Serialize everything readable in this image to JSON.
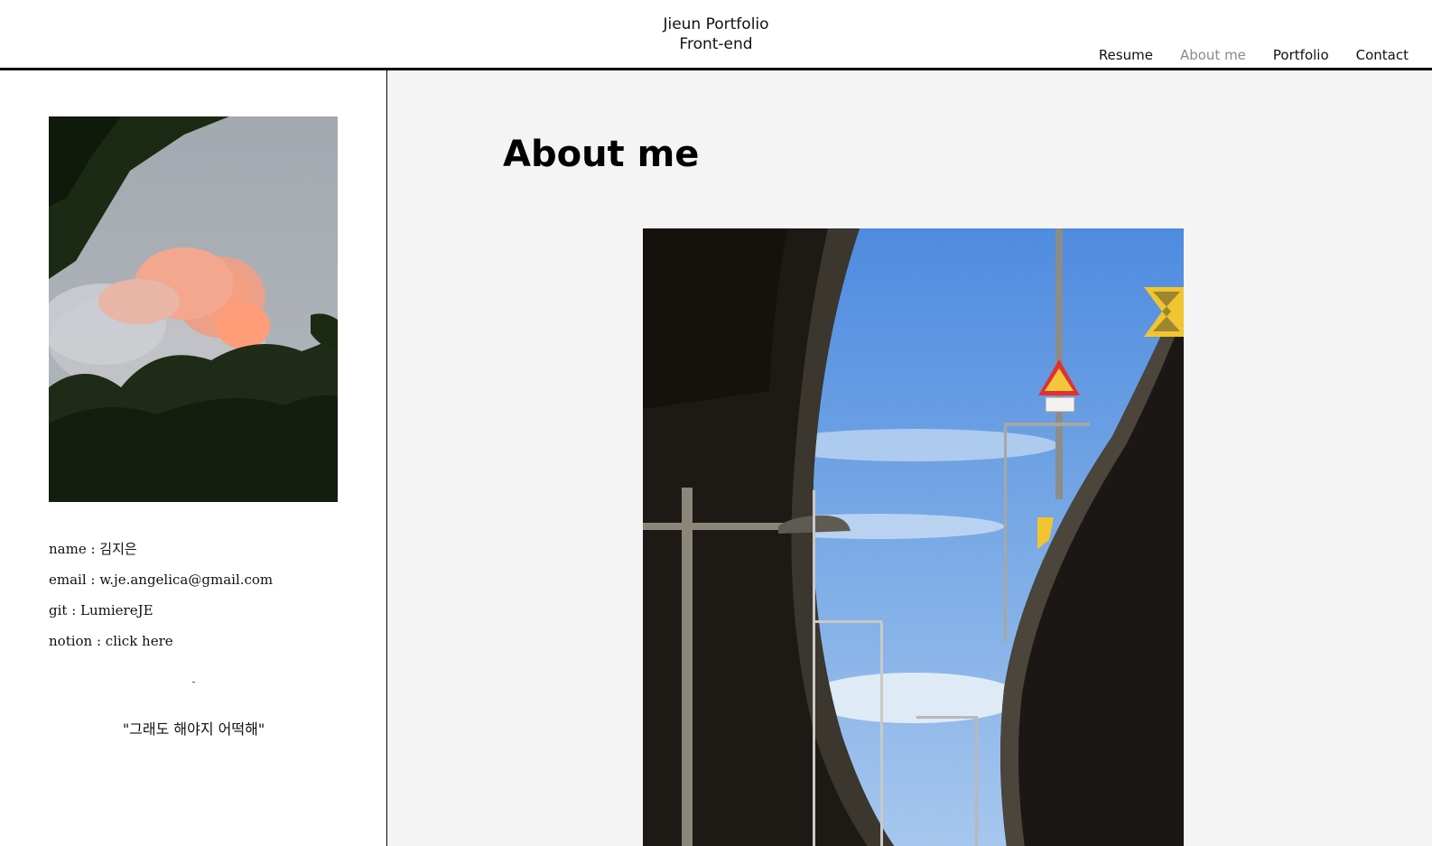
{
  "header": {
    "brand_line1": "Jieun Portfolio",
    "brand_line2": "Front-end",
    "nav": [
      {
        "label": "Resume",
        "active": false
      },
      {
        "label": "About me",
        "active": true
      },
      {
        "label": "Portfolio",
        "active": false
      },
      {
        "label": "Contact",
        "active": false
      }
    ]
  },
  "sidebar": {
    "info": {
      "name": "name : 김지은",
      "email": "email : w.je.angelica@gmail.com",
      "git": "git : LumiereJE",
      "notion": "notion : click here"
    },
    "divider": "-",
    "quote": "\"그래도 해야지 어떡해\""
  },
  "main": {
    "title": "About me"
  },
  "colors": {
    "header_border": "#000000",
    "main_bg": "#f4f4f4",
    "nav_active": "#8a8a8a",
    "text": "#111111"
  }
}
